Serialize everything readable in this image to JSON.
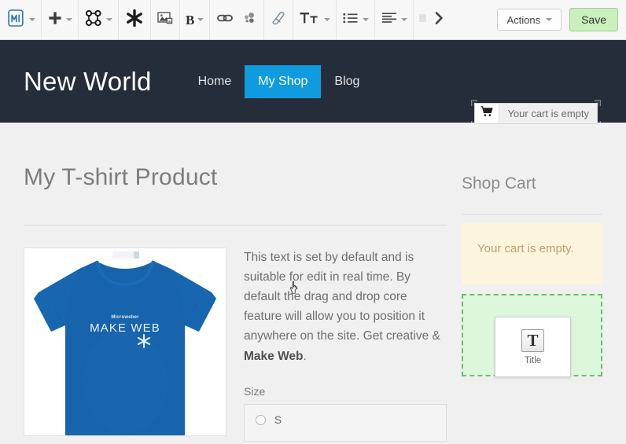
{
  "toolbar": {
    "groups": [
      {
        "name": "logo",
        "items": [
          {
            "icon": "microweber-logo-icon",
            "caret": true
          }
        ]
      },
      {
        "name": "add",
        "items": [
          {
            "icon": "plus-icon",
            "caret": true
          }
        ]
      },
      {
        "name": "modules",
        "items": [
          {
            "icon": "sitemap-icon",
            "caret": true
          }
        ]
      },
      {
        "name": "settings",
        "items": [
          {
            "icon": "asterisk-icon",
            "caret": false
          }
        ]
      },
      {
        "name": "media",
        "items": [
          {
            "icon": "image-icon",
            "caret": false
          }
        ]
      },
      {
        "name": "text-format",
        "items": [
          {
            "icon": "bold-icon",
            "caret": true,
            "label": "B"
          }
        ]
      },
      {
        "name": "link",
        "items": [
          {
            "icon": "link-icon",
            "caret": false
          },
          {
            "icon": "bubbles-icon",
            "caret": false
          }
        ]
      },
      {
        "name": "eraser",
        "items": [
          {
            "icon": "eraser-icon",
            "caret": false
          }
        ]
      },
      {
        "name": "typography",
        "items": [
          {
            "icon": "text-size-icon",
            "caret": true,
            "label": "Tт"
          }
        ]
      },
      {
        "name": "lists",
        "items": [
          {
            "icon": "unordered-list-icon",
            "caret": true
          }
        ]
      },
      {
        "name": "align",
        "items": [
          {
            "icon": "align-left-icon",
            "caret": true
          }
        ]
      },
      {
        "name": "overflow",
        "items": [
          {
            "icon": "faded-icon",
            "caret": false
          },
          {
            "icon": "chevron-right-icon",
            "caret": false
          }
        ]
      }
    ],
    "actions_label": "Actions",
    "save_label": "Save"
  },
  "site": {
    "logo": "New World",
    "nav": [
      {
        "label": "Home",
        "active": false
      },
      {
        "label": "My Shop",
        "active": true
      },
      {
        "label": "Blog",
        "active": false
      }
    ],
    "cart": {
      "icon": "shopping-cart-icon",
      "label": "Your cart is empty"
    }
  },
  "page": {
    "title": "My T-shirt Product",
    "product": {
      "image_alt": "blue-tshirt-make-web",
      "shirt_print_brand": "Microweber",
      "shirt_print_text": "MAKE WEB",
      "description_part1": "This text is set by default and is suitable for edit in real time. By default the drag and drop core feature will allow you to position it anywhere on the site. Get creative & ",
      "description_bold": "Make Web",
      "description_part3": ".",
      "size_label": "Size",
      "size_options": [
        {
          "label": "S",
          "selected": false
        }
      ]
    }
  },
  "sidebar": {
    "heading": "Shop Cart",
    "cart_empty_message": "Your cart is empty.",
    "drop_zone": {
      "card_icon": "T",
      "card_label": "Title"
    }
  },
  "colors": {
    "header_bg": "#262d3a",
    "nav_active": "#0f9bdd",
    "save_button_bg": "#c9f0bd",
    "alert_bg": "#fcf4dc",
    "drop_zone_bg": "#ddf7dc",
    "drop_zone_border": "#6cbf6a",
    "shirt_blue": "#1763ac"
  }
}
